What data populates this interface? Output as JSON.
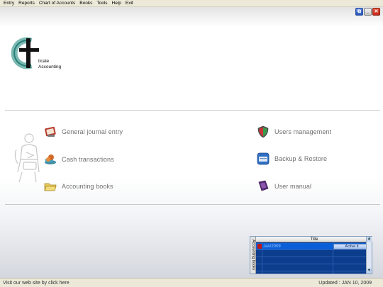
{
  "menu": [
    "Entry",
    "Reports",
    "Chart of Accounts",
    "Books",
    "Tools",
    "Help",
    "Exit"
  ],
  "window_controls": [
    "restore",
    "minimize",
    "close"
  ],
  "logo": {
    "line1": "ticale",
    "line2": "Accounting"
  },
  "features": {
    "general_journal": {
      "label": "General journal entry",
      "icon": "journal-icon"
    },
    "cash": {
      "label": "Cash transactions",
      "icon": "cash-icon"
    },
    "books": {
      "label": "Accounting books",
      "icon": "folder-icon"
    },
    "users": {
      "label": "Users management",
      "icon": "shield-users-icon"
    },
    "backup": {
      "label": "Backup & Restore",
      "icon": "backup-icon"
    },
    "manual": {
      "label": "User manual",
      "icon": "manual-book-icon"
    }
  },
  "books_panel": {
    "side_label": "Accounting books",
    "header": "Title",
    "rows": [
      {
        "title": "Jan/2009",
        "action": "Active it"
      }
    ]
  },
  "status": {
    "link": "Visit our web site by click here",
    "updated": "Updated : JAN 10, 2009"
  },
  "colors": {
    "accent": "#0c3c8c",
    "logo": "#2a7f78"
  }
}
